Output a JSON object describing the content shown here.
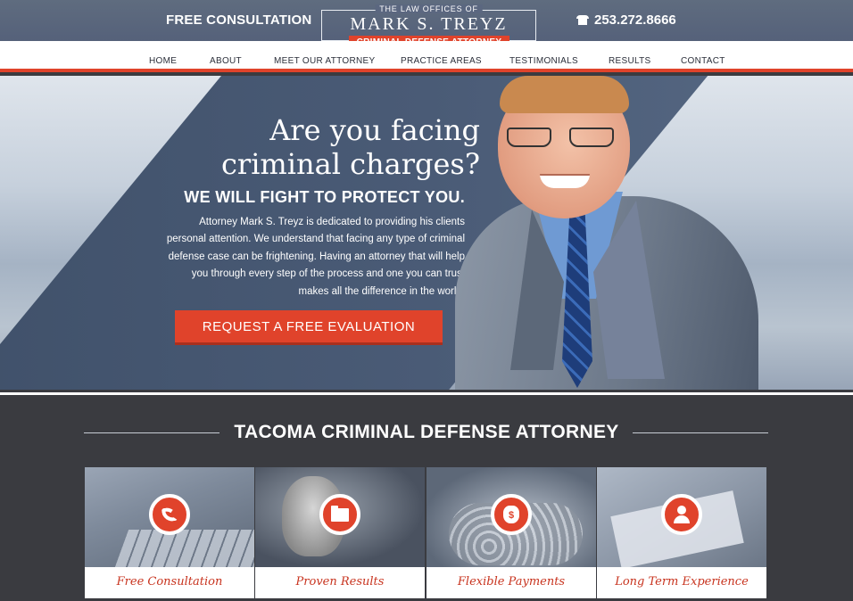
{
  "header": {
    "free_consultation": "FREE CONSULTATION",
    "logo_small": "THE LAW OFFICES OF",
    "logo_name": "MARK S. TREYZ",
    "logo_tagline": "CRIMINAL DEFENSE ATTORNEY",
    "phone": "253.272.8666",
    "phone_icon": "telephone-icon"
  },
  "nav": {
    "items": [
      {
        "label": "HOME"
      },
      {
        "label": "ABOUT"
      },
      {
        "label": "MEET OUR ATTORNEY"
      },
      {
        "label": "PRACTICE AREAS"
      },
      {
        "label": "TESTIMONIALS"
      },
      {
        "label": "RESULTS"
      },
      {
        "label": "CONTACT"
      }
    ]
  },
  "hero": {
    "title_line1": "Are you facing",
    "title_line2": "criminal charges?",
    "subtitle": "WE WILL FIGHT TO PROTECT YOU.",
    "body": "Attorney Mark S. Treyz is dedicated to providing his clients personal attention. We understand that facing any type of criminal defense case can be frightening. Having an attorney that will help you through every step of the process and one you can trust makes all the difference in the world.",
    "cta": "REQUEST A FREE EVALUATION"
  },
  "section": {
    "title": "TACOMA CRIMINAL DEFENSE ATTORNEY",
    "cards": [
      {
        "label": "Free Consultation",
        "icon": "phone-icon"
      },
      {
        "label": "Proven Results",
        "icon": "folder-icon"
      },
      {
        "label": "Flexible Payments",
        "icon": "money-bag-icon",
        "icon_glyph": "$"
      },
      {
        "label": "Long Term Experience",
        "icon": "user-icon"
      }
    ]
  },
  "colors": {
    "accent": "#e0432b",
    "topbar": "#5b6780",
    "section_bg": "#3a3b40",
    "card_label": "#c8341f"
  }
}
